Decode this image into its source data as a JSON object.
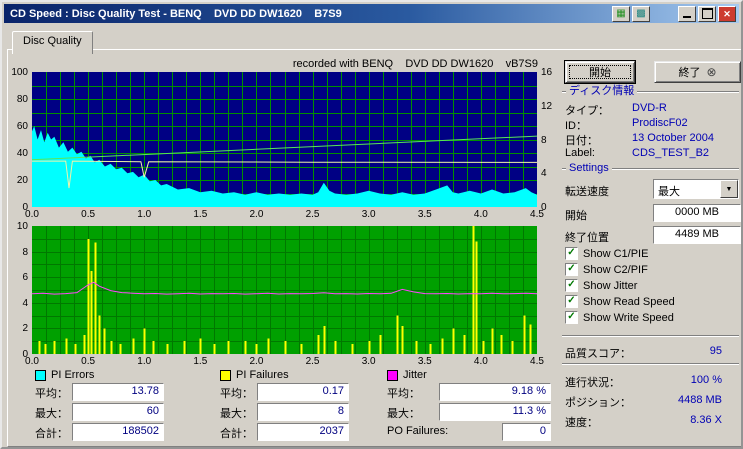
{
  "window": {
    "title": "CD Speed : Disc Quality Test - BENQ    DVD DD DW1620    B7S9"
  },
  "icons": {
    "check": "✓",
    "close": "✕",
    "exit": "⊗",
    "dropdown": "▼",
    "tool1": "▦",
    "tool2": "▩"
  },
  "tab": {
    "label": "Disc Quality"
  },
  "chart_header": {
    "text": "recorded with BENQ    DVD DD DW1620    vB7S9"
  },
  "charts": {
    "quality": {
      "xmin": 0,
      "xmax": 4.5,
      "ymin": 0,
      "ymax": 100,
      "grid": {
        "xstep": 0.125,
        "ystep": 10,
        "color": "#009000"
      },
      "left_ticks": [
        "100",
        "80",
        "60",
        "40",
        "20",
        "0"
      ],
      "right_ticks": [
        "16",
        "12",
        "8",
        "4",
        "0"
      ],
      "x_ticks": [
        "0.0",
        "0.5",
        "1.0",
        "1.5",
        "2.0",
        "2.5",
        "3.0",
        "3.5",
        "4.0",
        "4.5"
      ],
      "series": [
        {
          "name": "pi-errors-area",
          "type": "area",
          "color": "#00ffff",
          "points": [
            [
              0,
              56
            ],
            [
              0.02,
              60
            ],
            [
              0.05,
              50
            ],
            [
              0.08,
              57
            ],
            [
              0.11,
              48
            ],
            [
              0.14,
              55
            ],
            [
              0.17,
              50
            ],
            [
              0.2,
              52
            ],
            [
              0.24,
              44
            ],
            [
              0.28,
              48
            ],
            [
              0.32,
              41
            ],
            [
              0.36,
              44
            ],
            [
              0.4,
              39
            ],
            [
              0.44,
              41
            ],
            [
              0.48,
              36
            ],
            [
              0.52,
              38
            ],
            [
              0.56,
              33
            ],
            [
              0.6,
              35
            ],
            [
              0.65,
              30
            ],
            [
              0.7,
              32
            ],
            [
              0.75,
              28
            ],
            [
              0.8,
              29
            ],
            [
              0.85,
              25
            ],
            [
              0.9,
              26
            ],
            [
              0.95,
              22
            ],
            [
              1.0,
              24
            ],
            [
              1.05,
              19
            ],
            [
              1.1,
              20
            ],
            [
              1.15,
              16
            ],
            [
              1.2,
              17
            ],
            [
              1.3,
              13
            ],
            [
              1.4,
              14
            ],
            [
              1.5,
              11
            ],
            [
              1.6,
              12
            ],
            [
              1.7,
              10
            ],
            [
              1.8,
              11
            ],
            [
              1.9,
              9
            ],
            [
              2.0,
              11
            ],
            [
              2.1,
              9
            ],
            [
              2.2,
              10
            ],
            [
              2.3,
              9
            ],
            [
              2.4,
              10
            ],
            [
              2.5,
              9
            ],
            [
              2.55,
              11
            ],
            [
              2.6,
              18
            ],
            [
              2.65,
              12
            ],
            [
              2.7,
              10
            ],
            [
              2.8,
              9
            ],
            [
              2.9,
              10
            ],
            [
              3.0,
              12
            ],
            [
              3.1,
              10
            ],
            [
              3.2,
              9
            ],
            [
              3.3,
              11
            ],
            [
              3.4,
              9
            ],
            [
              3.5,
              10
            ],
            [
              3.6,
              13
            ],
            [
              3.7,
              16
            ],
            [
              3.75,
              11
            ],
            [
              3.8,
              10
            ],
            [
              3.9,
              12
            ],
            [
              4.0,
              10
            ],
            [
              4.1,
              13
            ],
            [
              4.2,
              10
            ],
            [
              4.3,
              11
            ],
            [
              4.4,
              14
            ],
            [
              4.45,
              11
            ],
            [
              4.5,
              9
            ]
          ]
        },
        {
          "name": "read-speed-line",
          "type": "line",
          "color": "#f2f2a8",
          "width": 1,
          "points": [
            [
              0,
              34
            ],
            [
              0.3,
              34
            ],
            [
              0.33,
              14
            ],
            [
              0.36,
              34
            ],
            [
              0.97,
              33.5
            ],
            [
              1.0,
              22
            ],
            [
              1.04,
              33.5
            ],
            [
              2.5,
              33.2
            ],
            [
              4.5,
              33
            ]
          ]
        },
        {
          "name": "write-speed-line",
          "type": "line",
          "color": "#59e659",
          "width": 1,
          "points": [
            [
              0,
              35
            ],
            [
              4.5,
              52.5
            ]
          ]
        }
      ]
    },
    "errors": {
      "xmin": 0,
      "xmax": 4.5,
      "ymin": 0,
      "ymax": 10,
      "grid": {
        "xstep": 0.125,
        "ystep": 1,
        "color": "#007800"
      },
      "left_ticks": [
        "10",
        "8",
        "6",
        "4",
        "2",
        "0"
      ],
      "x_ticks": [
        "0.0",
        "0.5",
        "1.0",
        "1.5",
        "2.0",
        "2.5",
        "3.0",
        "3.5",
        "4.0",
        "4.5"
      ],
      "series": [
        {
          "name": "pi-failures-bars",
          "type": "bars",
          "color": "#ffff00",
          "points": [
            [
              0.06,
              1
            ],
            [
              0.12,
              0.8
            ],
            [
              0.2,
              1
            ],
            [
              0.3,
              1.2
            ],
            [
              0.38,
              0.8
            ],
            [
              0.46,
              1.5
            ],
            [
              0.5,
              9
            ],
            [
              0.53,
              6.5
            ],
            [
              0.56,
              8.7
            ],
            [
              0.6,
              3
            ],
            [
              0.64,
              2
            ],
            [
              0.7,
              1
            ],
            [
              0.78,
              0.8
            ],
            [
              0.9,
              1.2
            ],
            [
              1.0,
              2
            ],
            [
              1.08,
              1
            ],
            [
              1.2,
              0.8
            ],
            [
              1.35,
              1
            ],
            [
              1.5,
              1.2
            ],
            [
              1.62,
              0.8
            ],
            [
              1.75,
              1
            ],
            [
              1.9,
              1
            ],
            [
              2.0,
              0.8
            ],
            [
              2.1,
              1.2
            ],
            [
              2.25,
              1
            ],
            [
              2.4,
              0.8
            ],
            [
              2.55,
              1.5
            ],
            [
              2.6,
              2.2
            ],
            [
              2.7,
              1
            ],
            [
              2.85,
              0.8
            ],
            [
              3.0,
              1
            ],
            [
              3.1,
              1.5
            ],
            [
              3.25,
              3
            ],
            [
              3.3,
              2.2
            ],
            [
              3.42,
              1
            ],
            [
              3.55,
              0.8
            ],
            [
              3.65,
              1.2
            ],
            [
              3.75,
              2
            ],
            [
              3.85,
              1.5
            ],
            [
              3.93,
              10
            ],
            [
              3.96,
              8.8
            ],
            [
              4.02,
              1
            ],
            [
              4.1,
              2
            ],
            [
              4.18,
              1.5
            ],
            [
              4.28,
              1
            ],
            [
              4.38,
              3
            ],
            [
              4.44,
              2.3
            ]
          ]
        },
        {
          "name": "jitter-line",
          "type": "line",
          "color": "#ff44ff",
          "width": 1,
          "points": [
            [
              0,
              4.7
            ],
            [
              0.1,
              4.75
            ],
            [
              0.2,
              4.68
            ],
            [
              0.3,
              4.72
            ],
            [
              0.4,
              4.8
            ],
            [
              0.5,
              5.4
            ],
            [
              0.55,
              5.6
            ],
            [
              0.6,
              5.3
            ],
            [
              0.7,
              4.95
            ],
            [
              0.8,
              4.8
            ],
            [
              0.9,
              4.75
            ],
            [
              1.0,
              4.7
            ],
            [
              1.1,
              4.73
            ],
            [
              1.2,
              4.68
            ],
            [
              1.3,
              4.7
            ],
            [
              1.4,
              4.74
            ],
            [
              1.5,
              4.69
            ],
            [
              1.6,
              4.72
            ],
            [
              1.7,
              4.7
            ],
            [
              1.8,
              4.73
            ],
            [
              1.9,
              4.68
            ],
            [
              2.0,
              4.71
            ],
            [
              2.1,
              4.74
            ],
            [
              2.2,
              4.69
            ],
            [
              2.3,
              4.72
            ],
            [
              2.4,
              4.7
            ],
            [
              2.5,
              4.73
            ],
            [
              2.6,
              4.78
            ],
            [
              2.7,
              4.7
            ],
            [
              2.8,
              4.72
            ],
            [
              2.9,
              4.69
            ],
            [
              3.0,
              4.73
            ],
            [
              3.1,
              4.7
            ],
            [
              3.2,
              4.74
            ],
            [
              3.3,
              5.05
            ],
            [
              3.4,
              4.85
            ],
            [
              3.5,
              4.72
            ],
            [
              3.6,
              4.7
            ],
            [
              3.7,
              4.73
            ],
            [
              3.8,
              4.69
            ],
            [
              3.9,
              4.72
            ],
            [
              4.0,
              4.7
            ],
            [
              4.1,
              4.74
            ],
            [
              4.2,
              4.7
            ],
            [
              4.3,
              4.72
            ],
            [
              4.4,
              4.75
            ],
            [
              4.5,
              4.7
            ]
          ]
        }
      ]
    }
  },
  "legend": {
    "items": [
      {
        "label": "PI Errors",
        "color": "#00ffff"
      },
      {
        "label": "PI Failures",
        "color": "#ffff00"
      },
      {
        "label": "Jitter",
        "color": "#ff00ff"
      }
    ]
  },
  "stats": {
    "pi_errors": {
      "rows": [
        {
          "label": "平均：",
          "value": "13.78"
        },
        {
          "label": "最大：",
          "value": "60"
        },
        {
          "label": "合計：",
          "value": "188502"
        }
      ]
    },
    "pi_failures": {
      "rows": [
        {
          "label": "平均：",
          "value": "0.17"
        },
        {
          "label": "最大：",
          "value": "8"
        },
        {
          "label": "合計：",
          "value": "2037"
        }
      ]
    },
    "jitter": {
      "rows": [
        {
          "label": "平均：",
          "value": "9.18 %"
        },
        {
          "label": "最大：",
          "value": "11.3 %"
        },
        {
          "label": "PO Failures:",
          "value": "0"
        }
      ]
    }
  },
  "buttons": {
    "start": "開始",
    "exit": "終了"
  },
  "disc_info": {
    "header": "ディスク情報",
    "rows": [
      {
        "label": "タイプ：",
        "value": "DVD-R"
      },
      {
        "label": "ID：",
        "value": "ProdiscF02"
      },
      {
        "label": "日付：",
        "value": "13 October 2004"
      },
      {
        "label": "Label:",
        "value": "CDS_TEST_B2"
      }
    ]
  },
  "settings": {
    "header": "Settings",
    "speed_label": "転送速度",
    "speed_value": "最大",
    "start_label": "開始",
    "start_value": "0000 MB",
    "end_label": "終了位置",
    "end_value": "4489 MB",
    "checkboxes": [
      {
        "label": "Show C1/PIE",
        "checked": true
      },
      {
        "label": "Show C2/PIF",
        "checked": true
      },
      {
        "label": "Show Jitter",
        "checked": true
      },
      {
        "label": "Show Read Speed",
        "checked": true
      },
      {
        "label": "Show Write Speed",
        "checked": true
      }
    ]
  },
  "quality_score": {
    "label": "品質スコア：",
    "value": "95"
  },
  "progress": {
    "rows": [
      {
        "label": "進行状況：",
        "value": "100 %"
      },
      {
        "label": "ポジション：",
        "value": "4488 MB"
      },
      {
        "label": "速度：",
        "value": "8.36 X"
      }
    ]
  }
}
